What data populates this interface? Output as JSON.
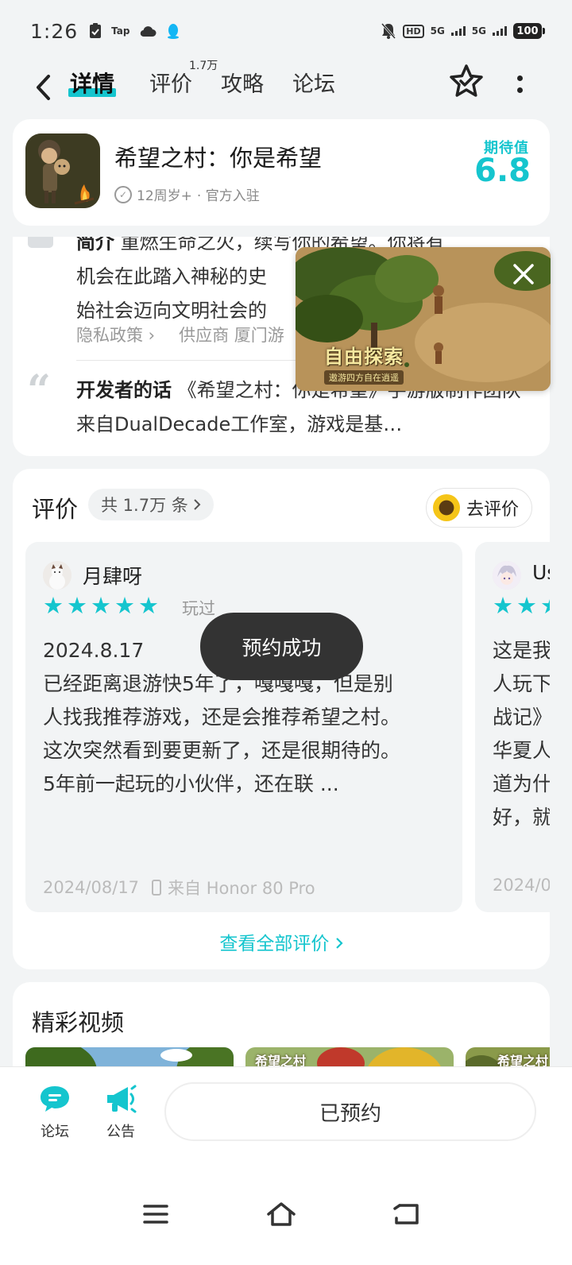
{
  "status_bar": {
    "time": "1:26",
    "tap_label": "Tap",
    "hd_label": "HD",
    "net_1": "5G",
    "net_2": "5G",
    "battery": "100"
  },
  "top_nav": {
    "tabs": [
      {
        "label": "详情"
      },
      {
        "label": "评价"
      },
      {
        "label": "攻略"
      },
      {
        "label": "论坛"
      }
    ],
    "review_count_badge": "1.7万"
  },
  "game": {
    "title": "希望之村：你是希望",
    "age_rating": "12周岁+",
    "official": "· 官方入驻",
    "expect_label": "期待值",
    "expect_value": "6.8"
  },
  "description": {
    "intro_label": "简介",
    "intro_text": "重燃生命之火，续写你的希望。你将有机会在此踏入神秘的史前世界，见证原始社会迈向文明社会的",
    "line1": "简介 重燃生命之火，续写你的希望。你将有",
    "line2": "机会在此踏入神秘的史",
    "line3": "始社会迈向文明社会的",
    "privacy_link": "隐私政策",
    "supplier": "供应商 厦门游",
    "dev_label": "开发者的话",
    "dev_text": "《希望之村：你是希望》手游版制作团队来自DualDecade工作室，游戏是基…"
  },
  "float_video": {
    "caption": "自由探索",
    "sub_caption": "遨游四方自在逍遥"
  },
  "reviews": {
    "title": "评价",
    "count_label": "共 1.7万 条",
    "rate_button": "去评价",
    "items": [
      {
        "user": "月肆呀",
        "rating": 5,
        "status": "玩过",
        "body_line1": "2024.8.17",
        "body_line2": "已经距离退游快5年了，嘎嘎嘎，但是别",
        "body_line3": "人找我推荐游戏，还是会推荐希望之村。",
        "body_line4": "这次突然看到要更新了，还是很期待的。",
        "body_line5": "5年前一起玩的小伙伴，还在联 ...",
        "date": "2024/08/17",
        "device": "来自 Honor 80 Pro"
      },
      {
        "user": "Us",
        "rating": 5,
        "body_line1": "这是我",
        "body_line2": "人玩下",
        "body_line3": "战记》",
        "body_line4": "华夏人",
        "body_line5": "道为什",
        "body_line6": "好，就",
        "date": "2024/0"
      }
    ],
    "see_all": "查看全部评价"
  },
  "toast": "预约成功",
  "videos": {
    "title": "精彩视频",
    "thumb2_label": "希望之村",
    "thumb3_label": "希望之村"
  },
  "bottom_bar": {
    "forum": "论坛",
    "notice": "公告",
    "reserve": "已预约"
  },
  "colors": {
    "accent": "#15c5ce",
    "toast_bg": "#333333"
  }
}
